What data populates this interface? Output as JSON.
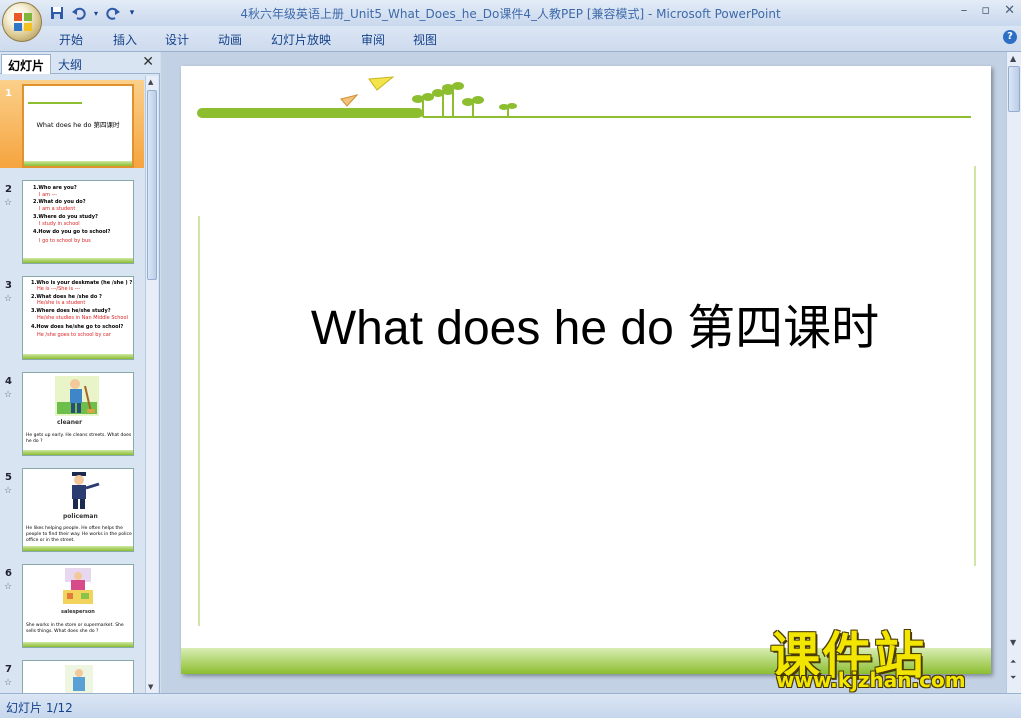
{
  "window": {
    "title": "4秋六年级英语上册_Unit5_What_Does_he_Do课件4_人教PEP [兼容模式] - ",
    "app_name": "Microsoft PowerPoint"
  },
  "ribbon": {
    "tabs": [
      "开始",
      "插入",
      "设计",
      "动画",
      "幻灯片放映",
      "审阅",
      "视图"
    ]
  },
  "panel": {
    "tab_slides": "幻灯片",
    "tab_outline": "大纲"
  },
  "thumbnails": [
    {
      "num": "1",
      "title": "What does he do 第四课时"
    },
    {
      "num": "2",
      "lines": [
        {
          "t": "1.Who are you?",
          "c": "b"
        },
        {
          "t": "I am ---",
          "c": "r"
        },
        {
          "t": "2.What do you do?",
          "c": "b"
        },
        {
          "t": "I am a student",
          "c": "r"
        },
        {
          "t": "3.Where do you study?",
          "c": "b"
        },
        {
          "t": "I study in school",
          "c": "r"
        },
        {
          "t": "4.How do you go to school?",
          "c": "b"
        },
        {
          "t": "I go to school by bus",
          "c": "r"
        }
      ]
    },
    {
      "num": "3",
      "lines": [
        {
          "t": "1.Who is your  deskmate  (he /she ) ?",
          "c": "b"
        },
        {
          "t": "He is ---/She is ---",
          "c": "r"
        },
        {
          "t": "2.What does he /she do ?",
          "c": "b"
        },
        {
          "t": "He/she is a student",
          "c": "r"
        },
        {
          "t": "3.Where does he/she  study?",
          "c": "b"
        },
        {
          "t": "He/she studies in Nan Middle School",
          "c": "r"
        },
        {
          "t": "4.How does he/she  go to school?",
          "c": "b"
        },
        {
          "t": "He /she goes to school by car",
          "c": "r"
        }
      ]
    },
    {
      "num": "4",
      "label": "cleaner",
      "caption": "He gets up early. He cleans streets. What does he do ?"
    },
    {
      "num": "5",
      "label": "policeman",
      "caption": "He likes helping people. He often helps the people to find their way. He works in the police office or in the street."
    },
    {
      "num": "6",
      "label": "salesperson",
      "caption": "She works in the store or supermarket. She sells things. What does she do ?"
    },
    {
      "num": "7"
    }
  ],
  "slide": {
    "title": "What does he do 第四课时"
  },
  "status": {
    "text": "幻灯片 1/12"
  },
  "watermark": {
    "brand": "课件站",
    "url": "www.kjzhan.com"
  },
  "colors": {
    "accent_green": "#8cbe30",
    "light_green": "#cfe7a4",
    "selection_orange": "#f5a43f"
  }
}
